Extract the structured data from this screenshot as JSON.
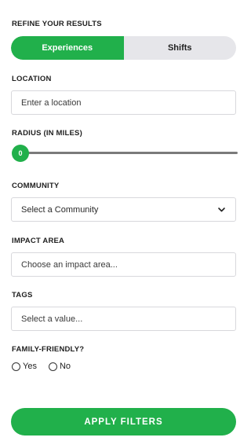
{
  "header": {
    "title": "REFINE YOUR RESULTS"
  },
  "toggle": {
    "active_label": "Experiences",
    "inactive_label": "Shifts"
  },
  "location": {
    "label": "LOCATION",
    "placeholder": "Enter a location"
  },
  "radius": {
    "label": "RADIUS (IN MILES)",
    "value": "0"
  },
  "community": {
    "label": "COMMUNITY",
    "selected": "Select a Community"
  },
  "impact_area": {
    "label": "IMPACT AREA",
    "placeholder": "Choose an impact area..."
  },
  "tags": {
    "label": "TAGS",
    "placeholder": "Select a value..."
  },
  "family_friendly": {
    "label": "FAMILY-FRIENDLY?",
    "options": [
      "Yes",
      "No"
    ]
  },
  "apply": {
    "label": "APPLY FILTERS"
  },
  "colors": {
    "accent": "#21b04b",
    "toggle_bg": "#e6e6ea",
    "border": "#d8d8dc"
  },
  "icons": {
    "dropdown": "chevron-down-icon",
    "radio": "radio-icon"
  }
}
